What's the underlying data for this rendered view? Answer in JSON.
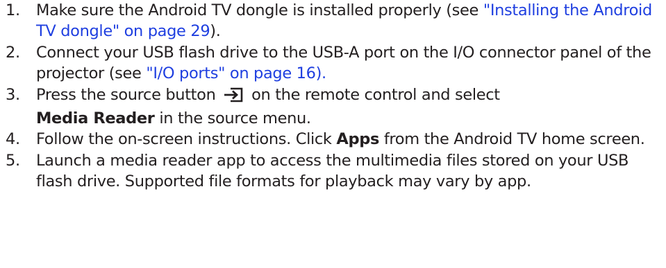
{
  "steps": [
    {
      "number": "1.",
      "text_before": "Make sure the Android TV dongle is installed properly (see ",
      "link": "\"Installing the Android TV dongle\" on page 29",
      "text_after": ")."
    },
    {
      "number": "2.",
      "text_before": "Connect your USB flash drive to the USB-A port on the I/O connector panel of the projector (see ",
      "link": "\"I/O ports\" on page 16).",
      "text_after": ""
    },
    {
      "number": "3.",
      "text_before": "Press the source button ",
      "icon": "source-input-icon",
      "text_mid": " on the remote control and select ",
      "bold": "Media Reader",
      "text_after": " in the source menu."
    },
    {
      "number": "4.",
      "text_before": "Follow the on-screen instructions. Click ",
      "bold": "Apps",
      "text_after": " from the Android TV home screen."
    },
    {
      "number": "5.",
      "text": "Launch a media reader app to access the multimedia files stored on your USB flash drive. Supported file formats for playback may vary by app."
    }
  ],
  "colors": {
    "text": "#231f20",
    "link": "#1f3fe0"
  }
}
